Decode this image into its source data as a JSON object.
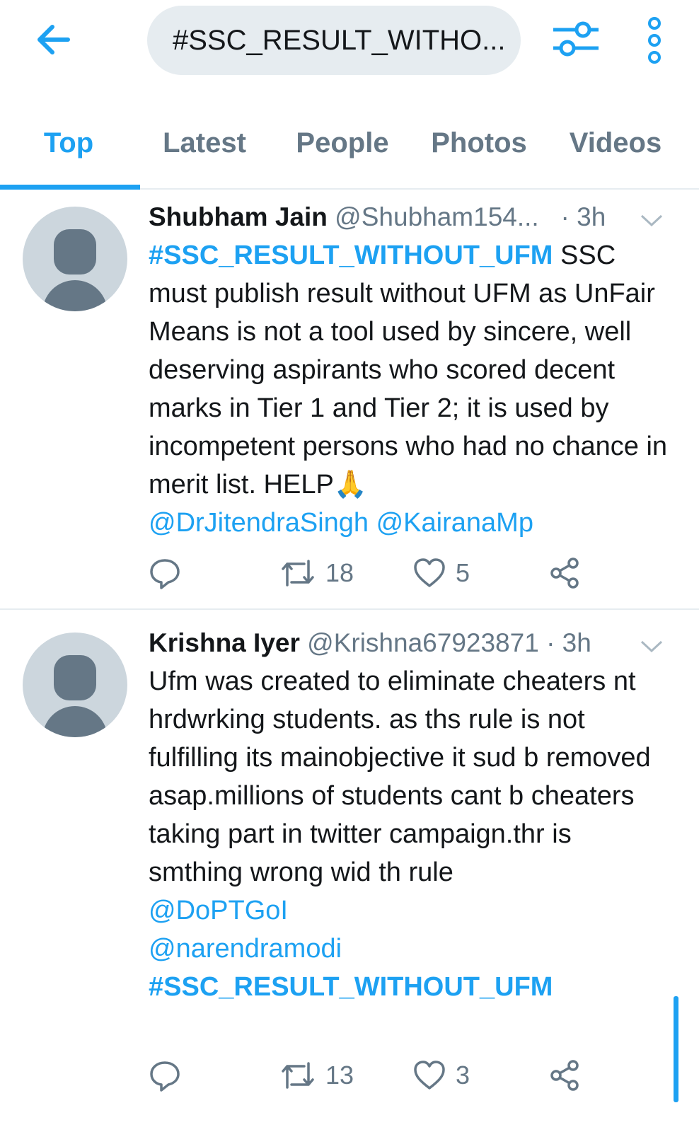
{
  "search": {
    "query": "#SSC_RESULT_WITHO..."
  },
  "tabs": [
    {
      "label": "Top"
    },
    {
      "label": "Latest"
    },
    {
      "label": "People"
    },
    {
      "label": "Photos"
    },
    {
      "label": "Videos"
    }
  ],
  "tweets": [
    {
      "name": "Shubham Jain",
      "handle": "@Shubham154...",
      "time": "· 3h",
      "hashtag_lead": "#SSC_RESULT_WITHOUT_UFM",
      "text": " SSC must publish result without UFM as UnFair Means is not a tool used by sincere, well deserving aspirants who scored decent marks in Tier 1 and Tier 2; it is used by incompetent persons who had no chance in merit list. HELP🙏",
      "mentions": "@DrJitendraSingh @KairanaMp",
      "retweets": "18",
      "likes": "5"
    },
    {
      "name": "Krishna Iyer",
      "handle": "@Krishna67923871",
      "time": "· 3h",
      "text": "Ufm was created to eliminate cheaters nt hrdwrking students. as ths rule is not fulfilling its mainobjective it sud b removed asap.millions of students cant b cheaters taking part in twitter campaign.thr is smthing wrong wid th rule",
      "mention1": "@DoPTGoI",
      "mention2": "@narendramodi",
      "hashtag_tail": "#SSC_RESULT_WITHOUT_UFM",
      "retweets": "13",
      "likes": "3"
    }
  ],
  "colors": {
    "accent": "#1da1f2",
    "muted": "#657786",
    "border": "#e6ecf0"
  }
}
